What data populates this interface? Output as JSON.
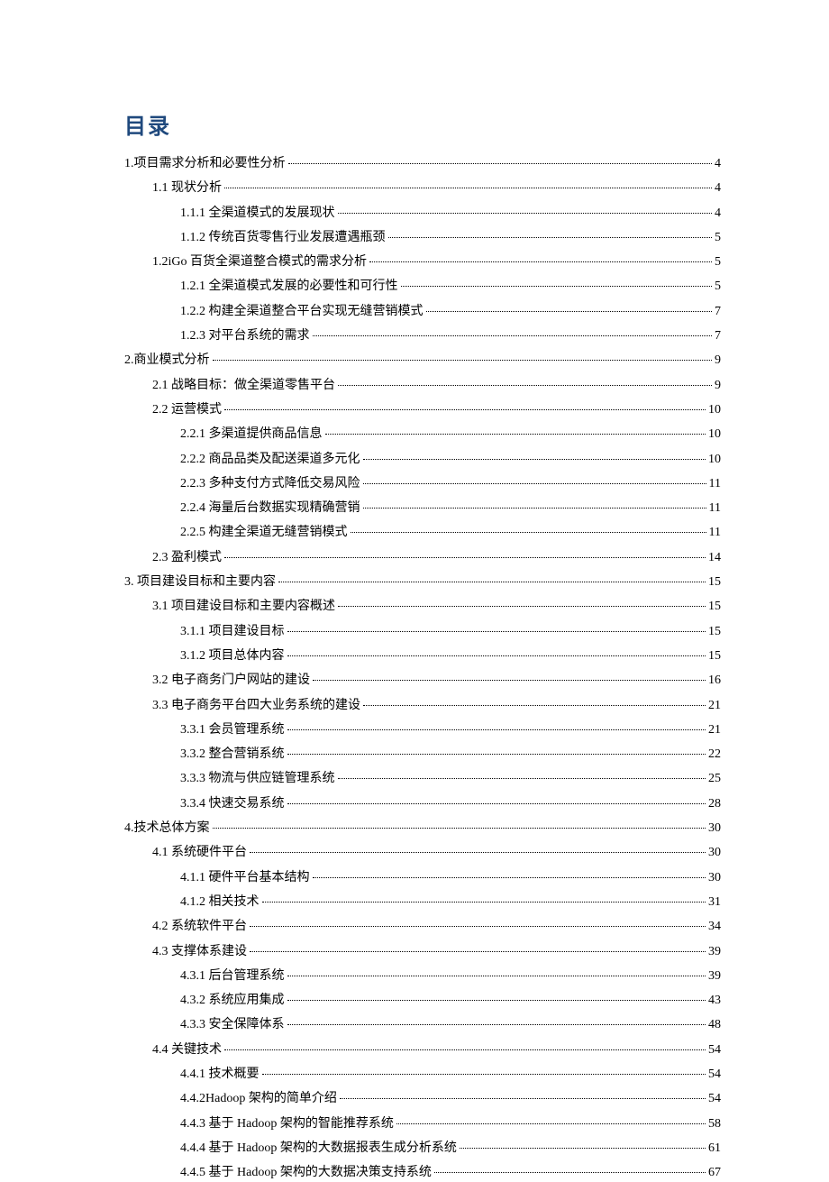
{
  "title": "目录",
  "entries": [
    {
      "level": 1,
      "text": "1.项目需求分析和必要性分析",
      "page": "4"
    },
    {
      "level": 2,
      "text": "1.1 现状分析",
      "page": "4"
    },
    {
      "level": 3,
      "text": "1.1.1 全渠道模式的发展现状",
      "page": "4"
    },
    {
      "level": 3,
      "text": "1.1.2 传统百货零售行业发展遭遇瓶颈",
      "page": "5"
    },
    {
      "level": 2,
      "text": "1.2iGo 百货全渠道整合模式的需求分析",
      "page": "5"
    },
    {
      "level": 3,
      "text": "1.2.1 全渠道模式发展的必要性和可行性",
      "page": "5"
    },
    {
      "level": 3,
      "text": "1.2.2 构建全渠道整合平台实现无缝营销模式",
      "page": "7"
    },
    {
      "level": 3,
      "text": "1.2.3 对平台系统的需求",
      "page": "7"
    },
    {
      "level": 1,
      "text": "2.商业模式分析",
      "page": "9"
    },
    {
      "level": 2,
      "text": "2.1 战略目标：做全渠道零售平台",
      "page": "9"
    },
    {
      "level": 2,
      "text": "2.2 运营模式",
      "page": "10"
    },
    {
      "level": 3,
      "text": "2.2.1 多渠道提供商品信息",
      "page": "10"
    },
    {
      "level": 3,
      "text": "2.2.2 商品品类及配送渠道多元化",
      "page": "10"
    },
    {
      "level": 3,
      "text": "2.2.3 多种支付方式降低交易风险",
      "page": "11"
    },
    {
      "level": 3,
      "text": "2.2.4 海量后台数据实现精确营销",
      "page": "11"
    },
    {
      "level": 3,
      "text": "2.2.5 构建全渠道无缝营销模式",
      "page": "11"
    },
    {
      "level": 2,
      "text": "2.3 盈利模式",
      "page": "14"
    },
    {
      "level": 1,
      "text": "3.  项目建设目标和主要内容",
      "page": "15"
    },
    {
      "level": 2,
      "text": "3.1 项目建设目标和主要内容概述",
      "page": "15"
    },
    {
      "level": 3,
      "text": "3.1.1 项目建设目标",
      "page": "15"
    },
    {
      "level": 3,
      "text": "3.1.2 项目总体内容",
      "page": "15"
    },
    {
      "level": 2,
      "text": "3.2 电子商务门户网站的建设",
      "page": "16"
    },
    {
      "level": 2,
      "text": "3.3 电子商务平台四大业务系统的建设",
      "page": "21"
    },
    {
      "level": 3,
      "text": "3.3.1 会员管理系统",
      "page": "21"
    },
    {
      "level": 3,
      "text": "3.3.2 整合营销系统",
      "page": "22"
    },
    {
      "level": 3,
      "text": "3.3.3 物流与供应链管理系统",
      "page": "25"
    },
    {
      "level": 3,
      "text": "3.3.4 快速交易系统",
      "page": "28"
    },
    {
      "level": 1,
      "text": "4.技术总体方案",
      "page": "30"
    },
    {
      "level": 2,
      "text": "4.1 系统硬件平台",
      "page": "30"
    },
    {
      "level": 3,
      "text": "4.1.1 硬件平台基本结构",
      "page": "30"
    },
    {
      "level": 3,
      "text": "4.1.2 相关技术",
      "page": "31"
    },
    {
      "level": 2,
      "text": "4.2 系统软件平台",
      "page": "34"
    },
    {
      "level": 2,
      "text": "4.3 支撑体系建设",
      "page": "39"
    },
    {
      "level": 3,
      "text": "4.3.1 后台管理系统",
      "page": "39"
    },
    {
      "level": 3,
      "text": "4.3.2 系统应用集成",
      "page": "43"
    },
    {
      "level": 3,
      "text": "4.3.3 安全保障体系",
      "page": "48"
    },
    {
      "level": 2,
      "text": "4.4 关键技术",
      "page": "54"
    },
    {
      "level": 3,
      "text": "4.4.1 技术概要",
      "page": "54"
    },
    {
      "level": 3,
      "text": "4.4.2Hadoop 架构的简单介绍",
      "page": "54"
    },
    {
      "level": 3,
      "text": "4.4.3 基于 Hadoop 架构的智能推荐系统",
      "page": "58"
    },
    {
      "level": 3,
      "text": "4.4.4 基于 Hadoop 架构的大数据报表生成分析系统",
      "page": "61"
    },
    {
      "level": 3,
      "text": "4.4.5 基于 Hadoop 架构的大数据决策支持系统",
      "page": "67"
    }
  ]
}
